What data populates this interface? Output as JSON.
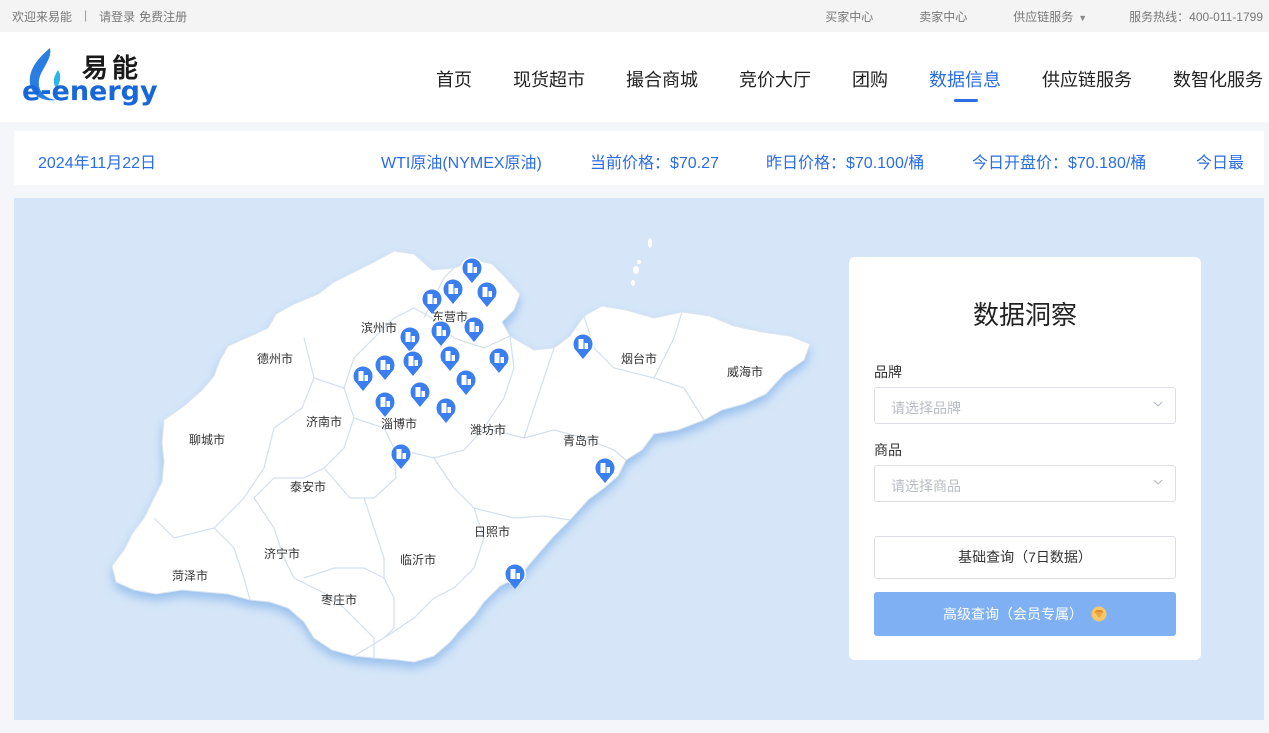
{
  "topbar": {
    "welcome": "欢迎来易能",
    "separator": "|",
    "login": "请登录",
    "register": "免费注册",
    "buyer_center": "买家中心",
    "seller_center": "卖家中心",
    "supply_chain": "供应链服务",
    "hotline": "服务热线：400-011-1799"
  },
  "logo": {
    "cn": "易能",
    "en": "e-energy"
  },
  "nav": {
    "items": [
      "首页",
      "现货超市",
      "撮合商城",
      "竞价大厅",
      "团购",
      "数据信息",
      "供应链服务",
      "数智化服务"
    ],
    "active": "数据信息"
  },
  "ticker": {
    "date": "2024年11月22日",
    "product": "WTI原油(NYMEX原油)",
    "current_price": "当前价格：$70.27",
    "yesterday_price": "昨日价格：$70.100/桶",
    "open_price": "今日开盘价：$70.180/桶",
    "today_more": "今日最"
  },
  "map": {
    "cities": [
      "德州市",
      "滨州市",
      "东营市",
      "烟台市",
      "威海市",
      "济南市",
      "淄博市",
      "潍坊市",
      "青岛市",
      "聊城市",
      "泰安市",
      "日照市",
      "济宁市",
      "临沂市",
      "菏泽市",
      "枣庄市"
    ],
    "marker_count": 21
  },
  "card": {
    "title": "数据洞察",
    "brand_label": "品牌",
    "brand_placeholder": "请选择品牌",
    "product_label": "商品",
    "product_placeholder": "请选择商品",
    "basic_query": "基础查询（7日数据）",
    "advanced_query": "高级查询（会员专属）"
  },
  "colors": {
    "accent": "#2b6de5",
    "map_bg": "#d6e6f8",
    "button_primary": "#7fb0f4",
    "marker": "#3a7ef0"
  },
  "icons": {
    "select_chevron": "chevron-down-icon",
    "vip": "vip-diamond-icon",
    "marker": "factory-pin-icon",
    "dropdown": "caret-down-icon"
  }
}
